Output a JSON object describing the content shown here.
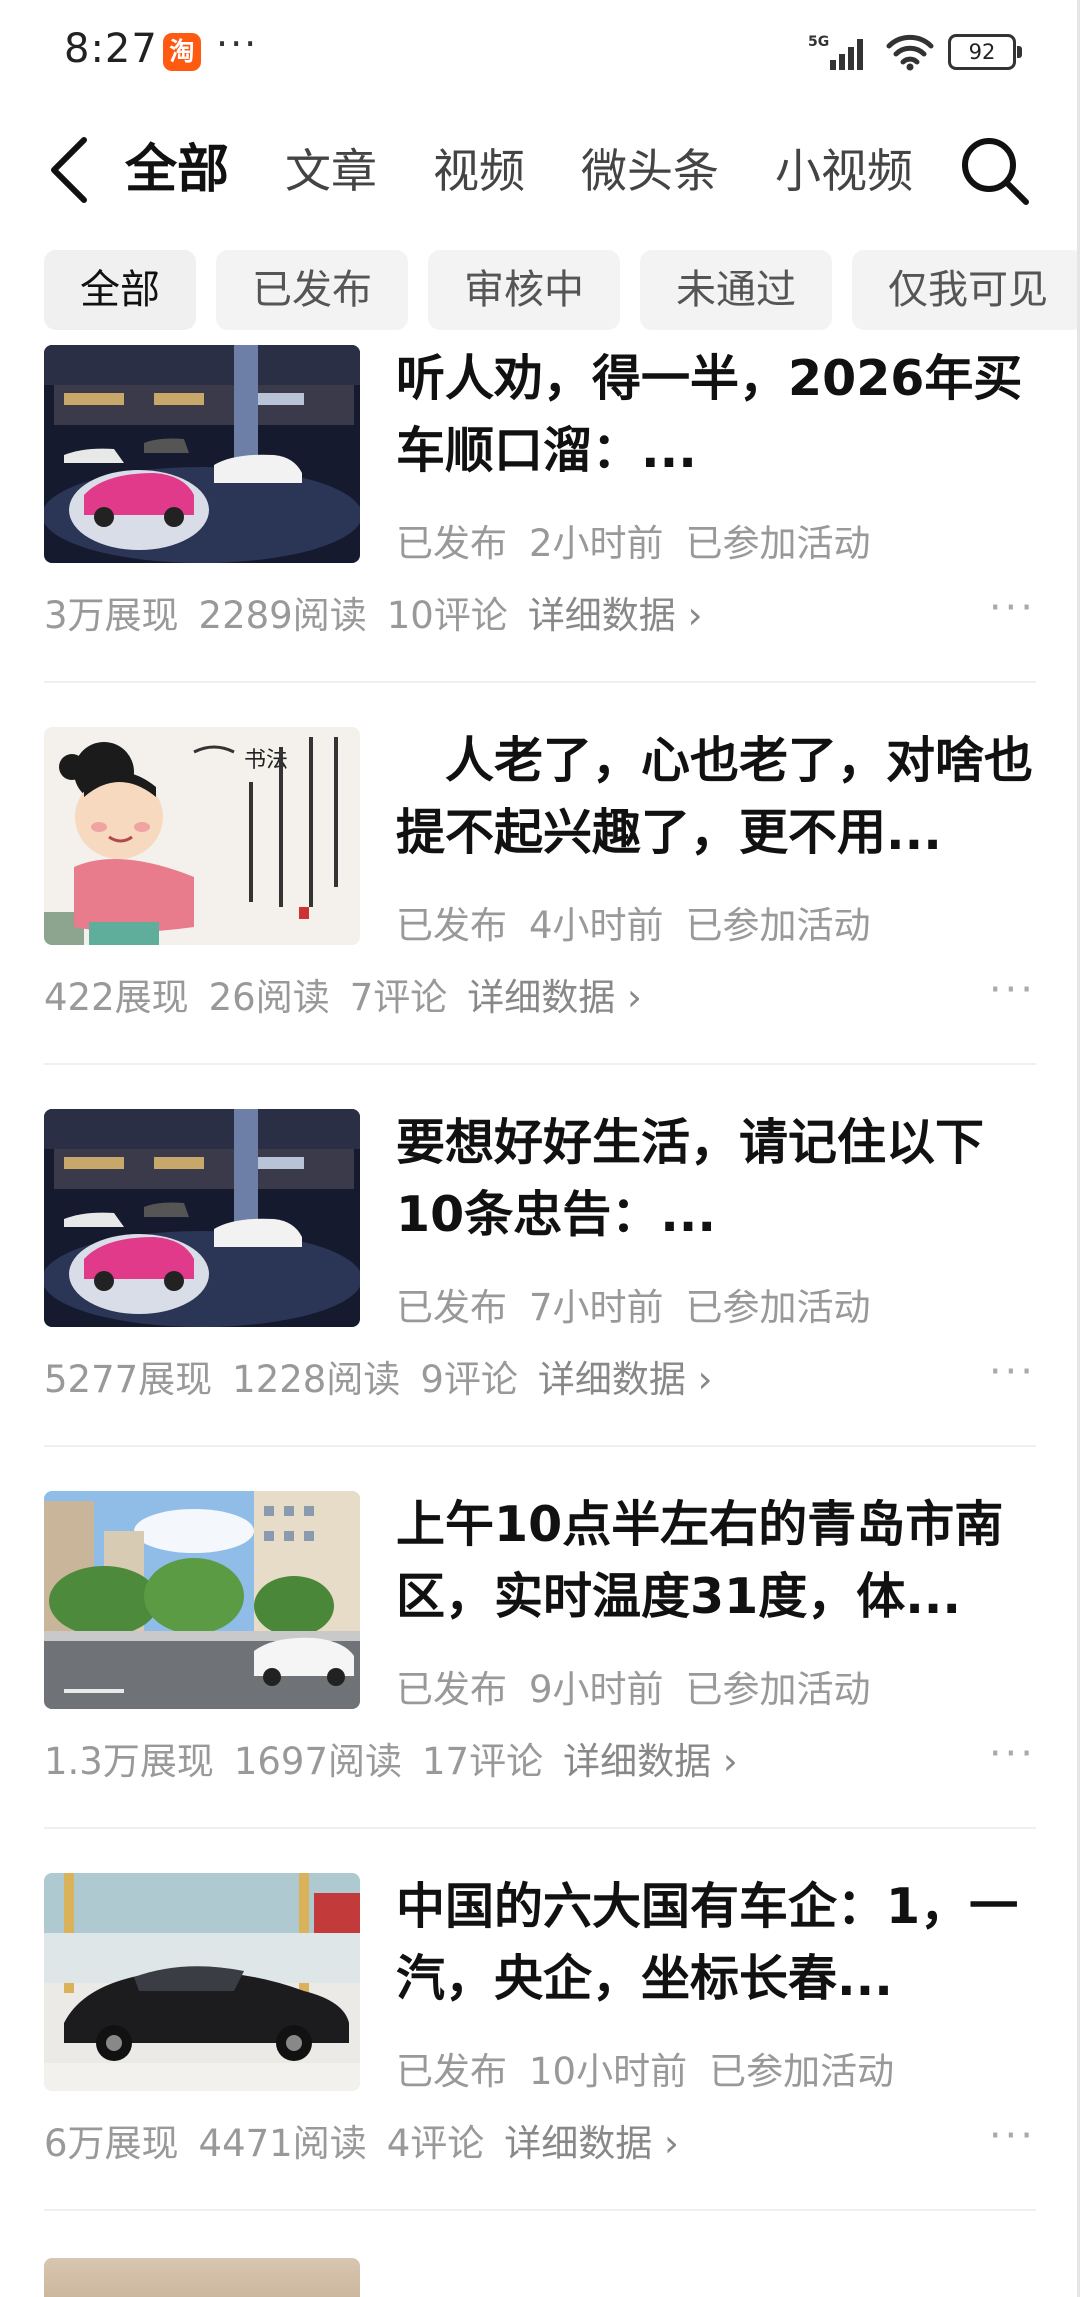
{
  "status_bar": {
    "time": "8:27",
    "app_badge": "淘",
    "overflow": "···",
    "network": "5G",
    "battery": "92"
  },
  "nav": {
    "tabs": [
      "全部",
      "文章",
      "视频",
      "微头条",
      "小视频"
    ],
    "active_tab": 0
  },
  "filters": {
    "chips": [
      "全部",
      "已发布",
      "审核中",
      "未通过",
      "仅我可见"
    ],
    "active_chip": 0
  },
  "posts": [
    {
      "title": "听人劝，得一半，2026年买车顺口溜：...",
      "status": "已发布",
      "time": "2小时前",
      "activity": "已参加活动",
      "impressions": "3万展现",
      "reads": "2289阅读",
      "comments": "10评论",
      "detail": "详细数据 ›",
      "more": "···",
      "thumb": "car-showroom-pink"
    },
    {
      "title": "　人老了，心也老了，对啥也提不起兴趣了，更不用...",
      "status": "已发布",
      "time": "4小时前",
      "activity": "已参加活动",
      "impressions": "422展现",
      "reads": "26阅读",
      "comments": "7评论",
      "detail": "详细数据 ›",
      "more": "···",
      "thumb": "painting-girl"
    },
    {
      "title": "要想好好生活，请记住以下10条忠告：...",
      "status": "已发布",
      "time": "7小时前",
      "activity": "已参加活动",
      "impressions": "5277展现",
      "reads": "1228阅读",
      "comments": "9评论",
      "detail": "详细数据 ›",
      "more": "···",
      "thumb": "car-showroom-pink"
    },
    {
      "title": "上午10点半左右的青岛市南区，实时温度31度，体...",
      "status": "已发布",
      "time": "9小时前",
      "activity": "已参加活动",
      "impressions": "1.3万展现",
      "reads": "1697阅读",
      "comments": "17评论",
      "detail": "详细数据 ›",
      "more": "···",
      "thumb": "city-street"
    },
    {
      "title": "中国的六大国有车企：1，一汽，央企，坐标长春...",
      "status": "已发布",
      "time": "10小时前",
      "activity": "已参加活动",
      "impressions": "6万展现",
      "reads": "4471阅读",
      "comments": "4评论",
      "detail": "详细数据 ›",
      "more": "···",
      "thumb": "black-sedan-showroom"
    }
  ]
}
